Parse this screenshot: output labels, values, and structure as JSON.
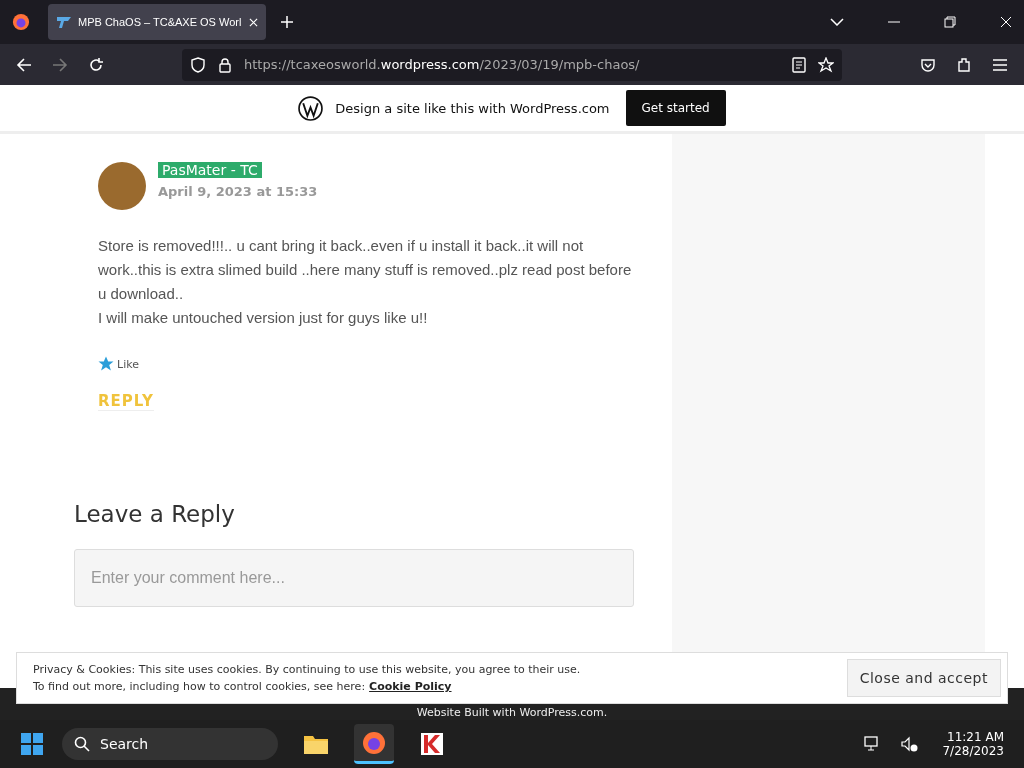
{
  "browser": {
    "tab": {
      "title": "MPB ChaOS – TC&AXE OS Worl",
      "selected": true
    },
    "url": {
      "prefix": "https://tcaxeosworld.",
      "domain": "wordpress.com",
      "path": "/2023/03/19/mpb-chaos/"
    }
  },
  "promo_bar": {
    "text": "Design a site like this with WordPress.com",
    "button": "Get started"
  },
  "comment": {
    "author": "PasMater - TC",
    "date": "April 9, 2023 at 15:33",
    "paragraphs": [
      "Store is removed!!!.. u cant bring it back..even if u install it back..it will not work..this is extra slimed build ..here many stuff is removed..plz read post before u download..",
      "I will make untouched version just for guys like u!!"
    ],
    "like": "Like",
    "reply": "REPLY"
  },
  "reply_form": {
    "heading": "Leave a Reply",
    "placeholder": "Enter your comment here..."
  },
  "cookie_banner": {
    "line_1": "Privacy & Cookies: This site uses cookies. By continuing to use this website, you agree to their use.",
    "line_2": "To find out more, including how to control cookies, see here:",
    "link": "Cookie Policy",
    "button": "Close and accept"
  },
  "footer": {
    "text": "Website Built with WordPress.com."
  },
  "taskbar": {
    "search": "Search",
    "time": "11:21 AM",
    "date": "7/28/2023",
    "apps": [
      {
        "kind": "files",
        "active": false
      },
      {
        "kind": "firefox",
        "active": true
      },
      {
        "kind": "antivirus",
        "active": false
      }
    ]
  }
}
